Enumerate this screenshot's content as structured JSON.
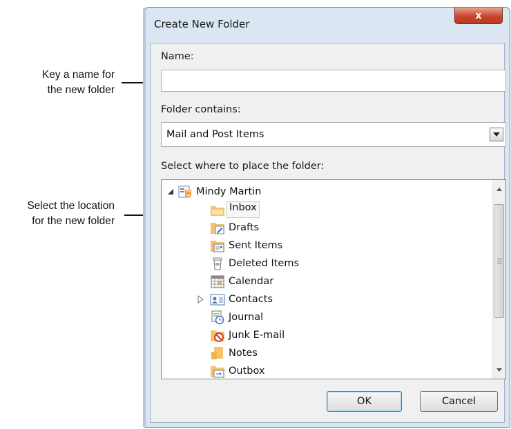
{
  "callouts": {
    "name": [
      "Key a name for",
      "the new folder"
    ],
    "location": [
      "Select the location",
      "for the new folder"
    ]
  },
  "dialog": {
    "title": "Create New Folder",
    "close_label": "x",
    "name_label": "Name:",
    "name_value": "",
    "contains_label": "Folder contains:",
    "contains_value": "Mail and Post Items",
    "location_label": "Select where to place the folder:",
    "ok_label": "OK",
    "cancel_label": "Cancel"
  },
  "tree": {
    "root": "Mindy Martin",
    "items": [
      "Inbox",
      "Drafts",
      "Sent Items",
      "Deleted Items",
      "Calendar",
      "Contacts",
      "Journal",
      "Junk E-mail",
      "Notes",
      "Outbox"
    ],
    "selected": "Inbox"
  },
  "colors": {
    "folder": "#f5c36b",
    "close_button": "#c9452c",
    "selection": "#f6f6f6"
  }
}
